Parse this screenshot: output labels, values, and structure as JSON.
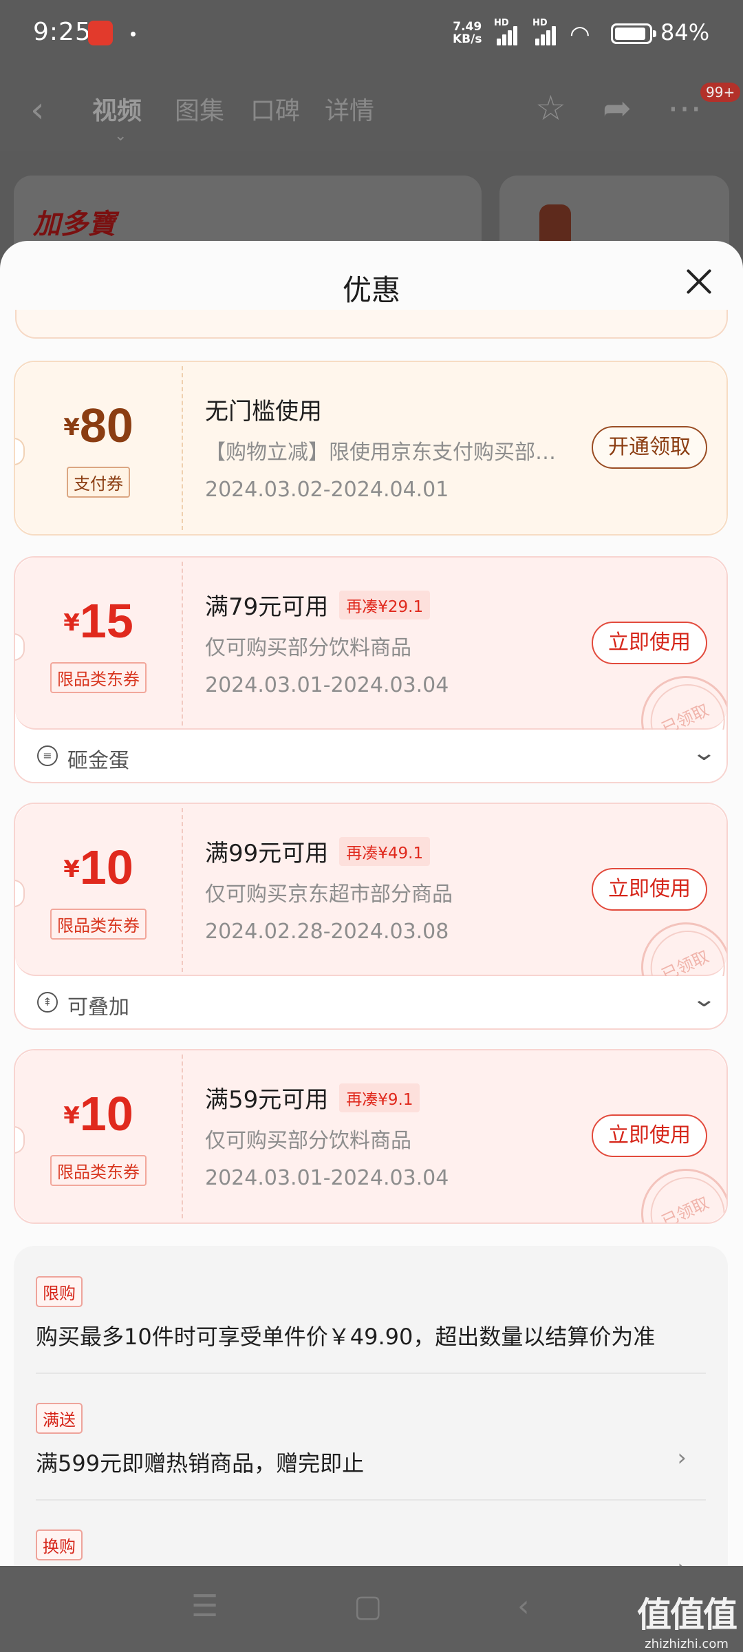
{
  "status_bar": {
    "time": "9:25",
    "net_speed_value": "7.49",
    "net_speed_unit": "KB/s",
    "sig1_label": "HD",
    "sig2_label": "HD",
    "battery": "84%"
  },
  "header": {
    "tabs": [
      "视频",
      "图集",
      "口碑",
      "详情"
    ],
    "active_tab": "视频",
    "badge": "99+"
  },
  "peek": {
    "brand": "加多寶"
  },
  "sheet": {
    "title": "优惠",
    "coupons": [
      {
        "currency": "¥",
        "amount": "80",
        "type_label": "支付券",
        "title": "无门槛使用",
        "chip": "",
        "desc": "【购物立减】限使用京东支付购买部…",
        "date": "2024.03.02-2024.04.01",
        "button": "开通领取",
        "style": "gold"
      },
      {
        "currency": "¥",
        "amount": "15",
        "type_label": "限品类东券",
        "title": "满79元可用",
        "chip": "再凑¥29.1",
        "desc": "仅可购买部分饮料商品",
        "date": "2024.03.01-2024.03.04",
        "button": "立即使用",
        "stamp": "已领取",
        "footer": "砸金蛋",
        "style": "red"
      },
      {
        "currency": "¥",
        "amount": "10",
        "type_label": "限品类东券",
        "title": "满99元可用",
        "chip": "再凑¥49.1",
        "desc": "仅可购买京东超市部分商品",
        "date": "2024.02.28-2024.03.08",
        "button": "立即使用",
        "stamp": "已领取",
        "footer": "可叠加",
        "style": "red"
      },
      {
        "currency": "¥",
        "amount": "10",
        "type_label": "限品类东券",
        "title": "满59元可用",
        "chip": "再凑¥9.1",
        "desc": "仅可购买部分饮料商品",
        "date": "2024.03.01-2024.03.04",
        "button": "立即使用",
        "stamp": "已领取",
        "style": "red"
      }
    ],
    "promotions": [
      {
        "tag": "限购",
        "text": "购买最多10件时可享受单件价￥49.90，超出数量以结算价为准"
      },
      {
        "tag": "满送",
        "text": "满599元即赠热销商品，赠完即止"
      },
      {
        "tag": "换购",
        "text": ""
      }
    ]
  },
  "watermark": {
    "logo": "值值值",
    "site": "zhizhizhi.com"
  },
  "colors": {
    "accent_red": "#e0291d",
    "gold": "#8b3d12",
    "sheet_bg": "#fbfbfb"
  },
  "icons": [
    "back-icon",
    "star-icon",
    "share-icon",
    "more-icon",
    "close-icon",
    "chevron-down-icon",
    "chevron-right-icon",
    "menu-icon",
    "home-icon",
    "back-nav-icon"
  ]
}
